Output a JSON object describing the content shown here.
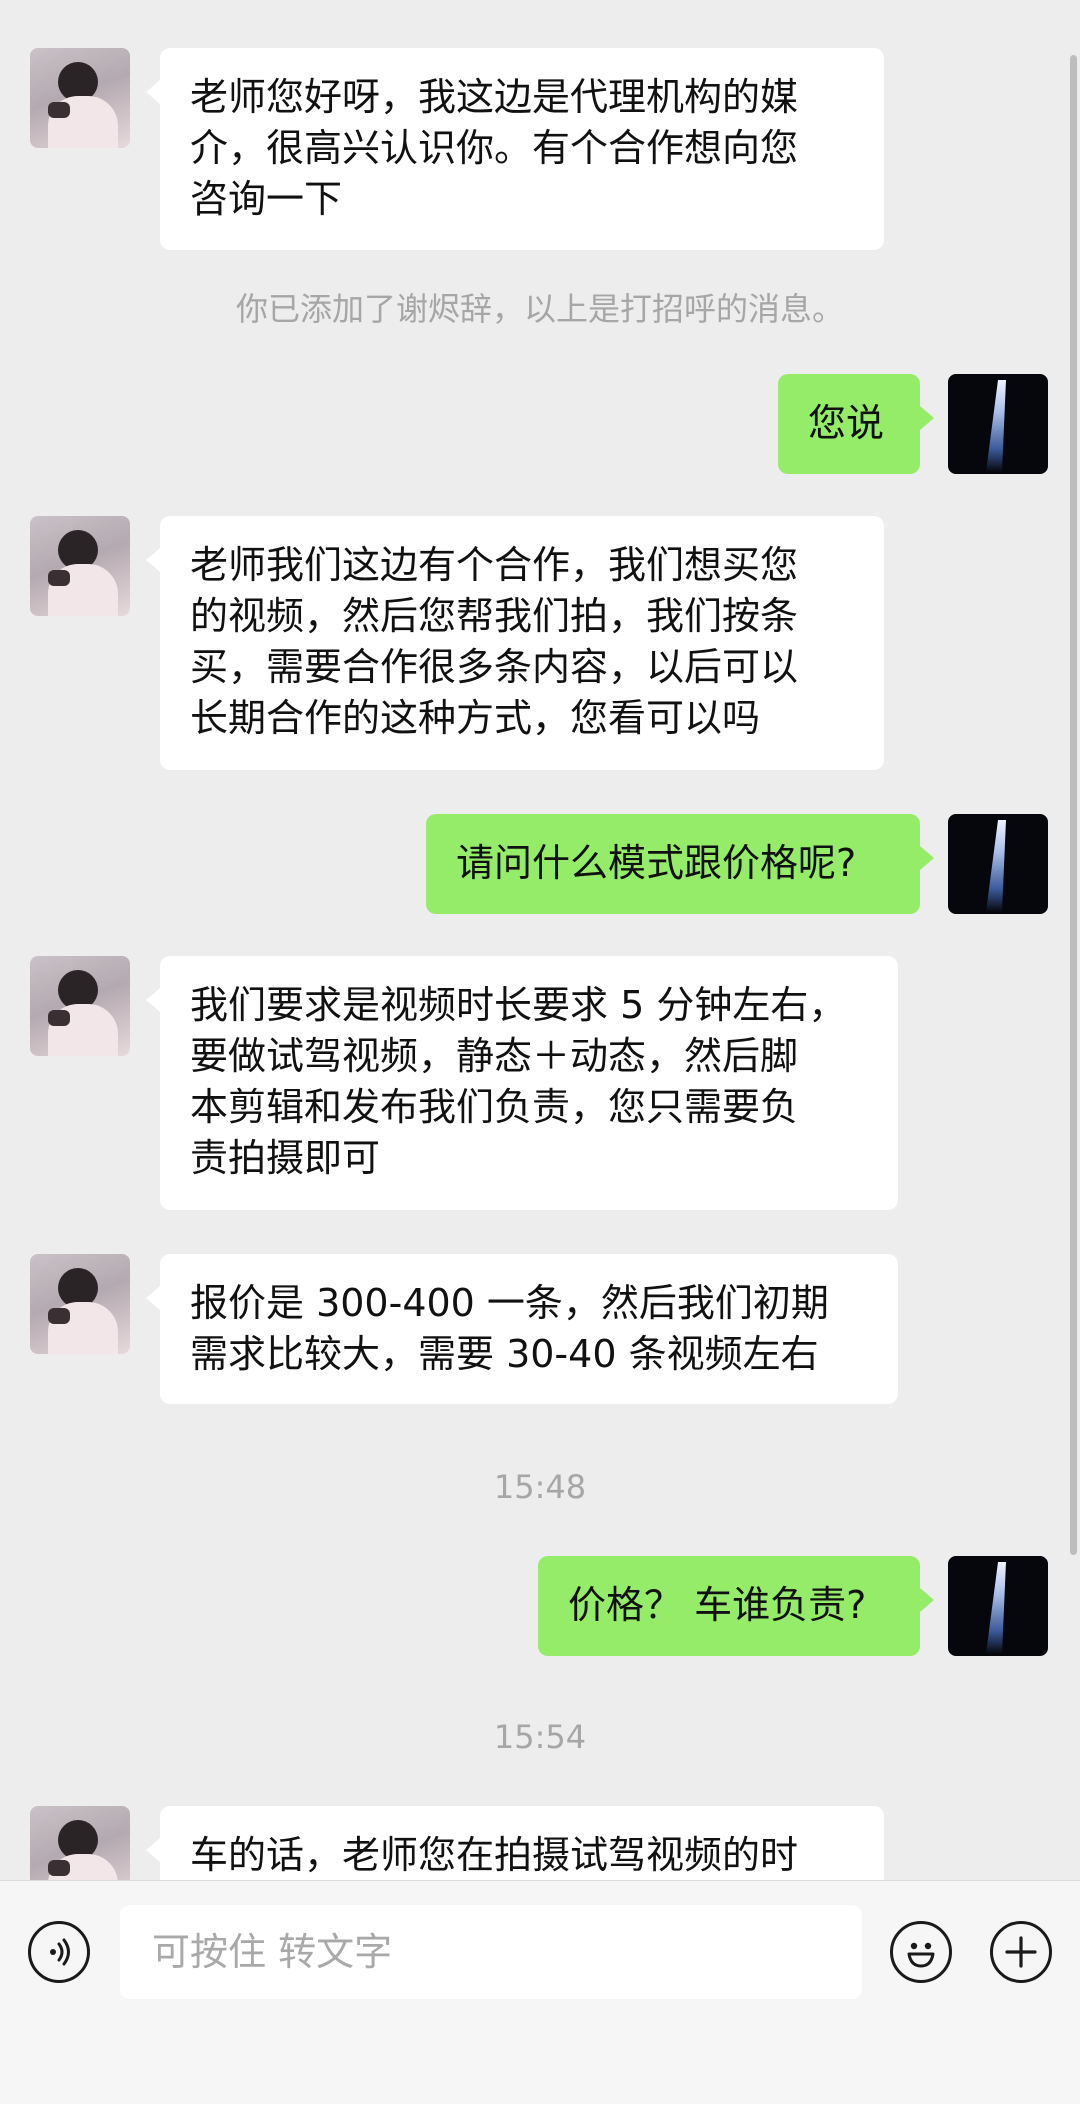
{
  "messages": [
    {
      "side": "left",
      "text": "老师您好呀，我这边是代理机构的媒\n介，很高兴认识你。有个合作想向您\n咨询一下"
    },
    {
      "side": "right",
      "text": "您说"
    },
    {
      "side": "left",
      "text": "老师我们这边有个合作，我们想买您\n的视频，然后您帮我们拍，我们按条\n买，需要合作很多条内容，以后可以\n长期合作的这种方式，您看可以吗"
    },
    {
      "side": "right",
      "text": "请问什么模式跟价格呢?"
    },
    {
      "side": "left",
      "text": "我们要求是视频时长要求 5 分钟左右，\n要做试驾视频，静态＋动态，然后脚\n本剪辑和发布我们负责，您只需要负\n责拍摄即可"
    },
    {
      "side": "left",
      "text": "报价是 300-400 一条，然后我们初期\n需求比较大，需要 30-40 条视频左右"
    },
    {
      "side": "right",
      "text": "价格？ 车谁负责?"
    },
    {
      "side": "left",
      "text": "车的话，老师您在拍摄试驾视频的时"
    }
  ],
  "system_notice": "你已添加了谢烬辞，以上是打招呼的消息。",
  "timestamps": [
    "15:48",
    "15:54"
  ],
  "input": {
    "placeholder": "可按住 转文字"
  },
  "icons": {
    "voice": "voice-icon",
    "emoji": "emoji-icon",
    "more": "plus-icon"
  },
  "colors": {
    "background": "#ededed",
    "bubble_self": "#95ec69",
    "bubble_other": "#ffffff"
  }
}
